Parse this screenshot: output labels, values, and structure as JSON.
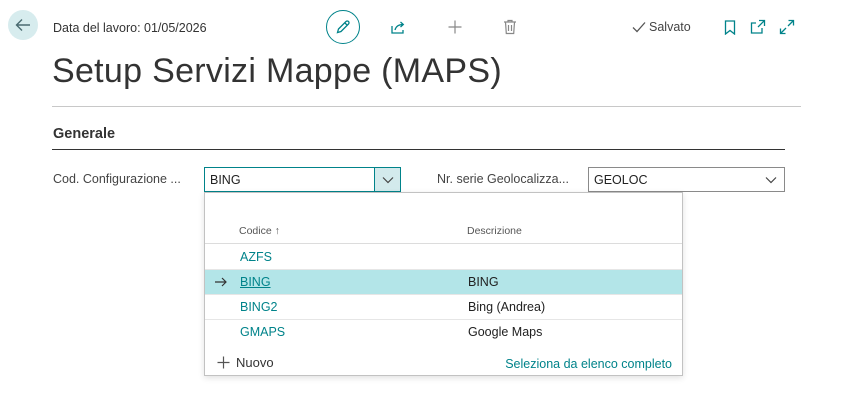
{
  "header": {
    "work_date": "Data del lavoro: 01/05/2026",
    "saved_status": "Salvato"
  },
  "page": {
    "title": "Setup Servizi Mappe (MAPS)"
  },
  "section": {
    "title": "Generale"
  },
  "fields": {
    "config_code": {
      "label": "Cod. Configurazione ...",
      "value": "BING"
    },
    "geo_series": {
      "label": "Nr. serie Geolocalizza...",
      "value": "GEOLOC"
    }
  },
  "lookup": {
    "col_code": "Codice",
    "col_code_sort": "↑",
    "col_desc": "Descrizione",
    "rows": [
      {
        "code": "AZFS",
        "desc": ""
      },
      {
        "code": "BING",
        "desc": "BING"
      },
      {
        "code": "BING2",
        "desc": "Bing (Andrea)"
      },
      {
        "code": "GMAPS",
        "desc": "Google Maps"
      }
    ],
    "new_label": "Nuovo",
    "full_list_label": "Seleziona da elenco completo"
  },
  "colors": {
    "accent": "#00838a",
    "selected_row": "#b3e5e8"
  }
}
